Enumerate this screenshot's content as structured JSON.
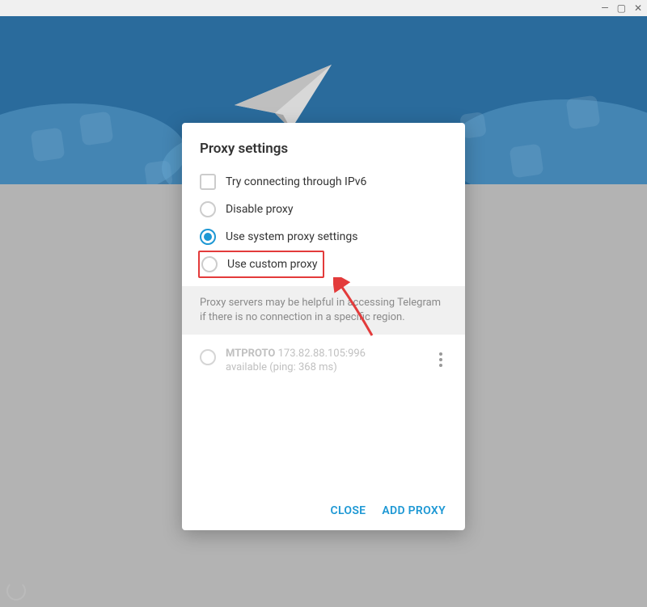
{
  "titlebar": {
    "min": "—",
    "max": "▢",
    "close": "✕"
  },
  "dialog": {
    "title": "Proxy settings",
    "options": {
      "ipv6": "Try connecting through IPv6",
      "disable": "Disable proxy",
      "system": "Use system proxy settings",
      "custom": "Use custom proxy"
    },
    "info": "Proxy servers may be helpful in accessing Telegram if there is no connection in a specific region.",
    "proxy": {
      "protocol": "MTPROTO",
      "addr": "173.82.88.105:996",
      "status": "available (ping: 368 ms)"
    },
    "actions": {
      "close": "CLOSE",
      "add": "ADD PROXY"
    }
  }
}
